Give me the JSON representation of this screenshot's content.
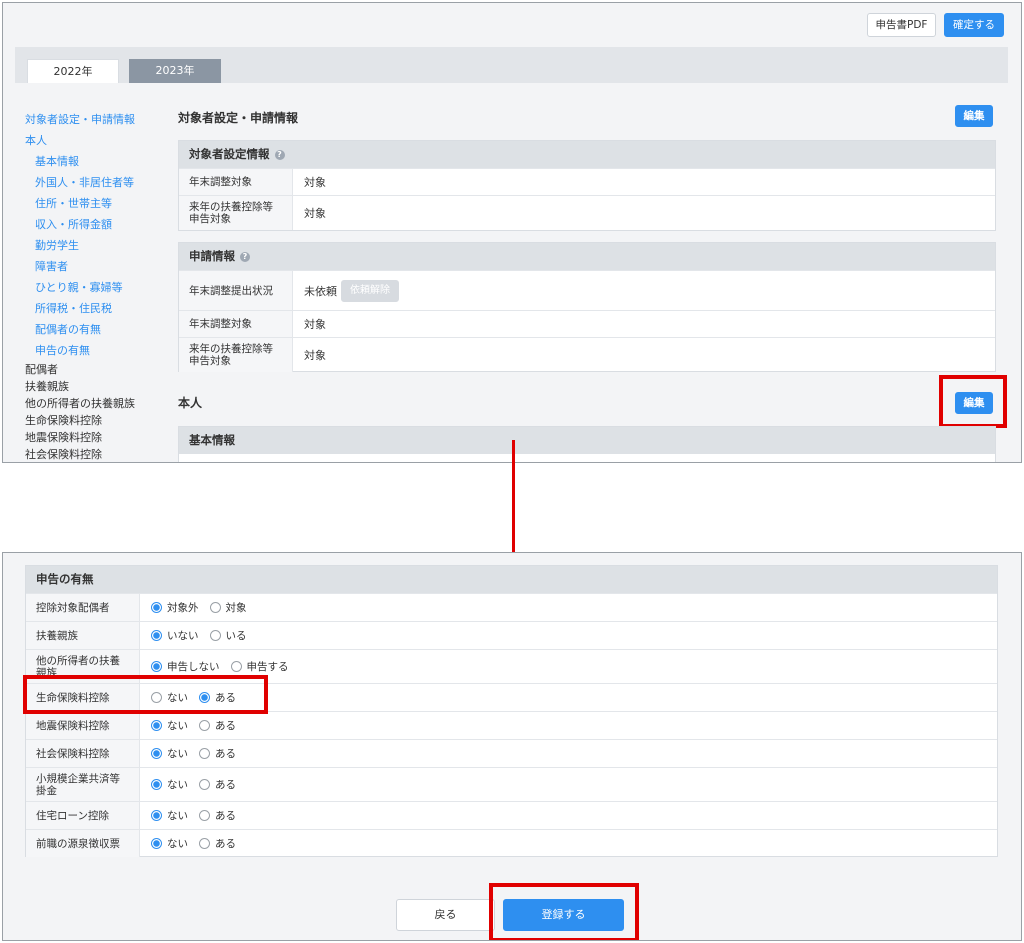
{
  "top_panel": {
    "header": {
      "pdf_button": "申告書PDF",
      "confirm_button": "確定する"
    },
    "tabs": [
      {
        "label": "2022年",
        "active": true
      },
      {
        "label": "2023年",
        "active": false
      }
    ],
    "sidebar": {
      "items": [
        {
          "label": "対象者設定・申請情報",
          "level": 1
        },
        {
          "label": "本人",
          "level": 1
        },
        {
          "label": "基本情報",
          "level": 2
        },
        {
          "label": "外国人・非居住者等",
          "level": 2
        },
        {
          "label": "住所・世帯主等",
          "level": 2
        },
        {
          "label": "収入・所得金額",
          "level": 2
        },
        {
          "label": "勤労学生",
          "level": 2
        },
        {
          "label": "障害者",
          "level": 2
        },
        {
          "label": "ひとり親・寡婦等",
          "level": 2
        },
        {
          "label": "所得税・住民税",
          "level": 2
        },
        {
          "label": "配偶者の有無",
          "level": 2
        },
        {
          "label": "申告の有無",
          "level": 2
        },
        {
          "label": "配偶者",
          "level": 0
        },
        {
          "label": "扶養親族",
          "level": 0
        },
        {
          "label": "他の所得者の扶養親族",
          "level": 0
        },
        {
          "label": "生命保険料控除",
          "level": 0
        },
        {
          "label": "地震保険料控除",
          "level": 0
        },
        {
          "label": "社会保険料控除",
          "level": 0
        }
      ]
    },
    "main": {
      "section1_title": "対象者設定・申請情報",
      "edit_label": "編集",
      "target_settings": {
        "title": "対象者設定情報",
        "help_icon": "?",
        "rows": [
          {
            "label": "年末調整対象",
            "value": "対象"
          },
          {
            "label": "来年の扶養控除等申告対象",
            "value": "対象"
          }
        ]
      },
      "request_info": {
        "title": "申請情報",
        "help_icon": "?",
        "status_label": "年末調整提出状況",
        "status_value": "未依頼",
        "cancel_button": "依頼解除",
        "rows": [
          {
            "label": "年末調整対象",
            "value": "対象"
          },
          {
            "label": "来年の扶養控除等申告対象",
            "value": "対象"
          }
        ]
      },
      "section2_title": "本人",
      "basic_info_title": "基本情報"
    }
  },
  "bottom_panel": {
    "card_title": "申告の有無",
    "rows": [
      {
        "label": "控除対象配偶者",
        "options": [
          {
            "text": "対象外",
            "checked": true
          },
          {
            "text": "対象",
            "checked": false
          }
        ]
      },
      {
        "label": "扶養親族",
        "options": [
          {
            "text": "いない",
            "checked": true
          },
          {
            "text": "いる",
            "checked": false
          }
        ]
      },
      {
        "label": "他の所得者の扶養親族",
        "options": [
          {
            "text": "申告しない",
            "checked": true
          },
          {
            "text": "申告する",
            "checked": false
          }
        ]
      },
      {
        "label": "生命保険料控除",
        "options": [
          {
            "text": "ない",
            "checked": false
          },
          {
            "text": "ある",
            "checked": true
          }
        ]
      },
      {
        "label": "地震保険料控除",
        "options": [
          {
            "text": "ない",
            "checked": true
          },
          {
            "text": "ある",
            "checked": false
          }
        ]
      },
      {
        "label": "社会保険料控除",
        "options": [
          {
            "text": "ない",
            "checked": true
          },
          {
            "text": "ある",
            "checked": false
          }
        ]
      },
      {
        "label": "小規模企業共済等掛金",
        "options": [
          {
            "text": "ない",
            "checked": true
          },
          {
            "text": "ある",
            "checked": false
          }
        ]
      },
      {
        "label": "住宅ローン控除",
        "options": [
          {
            "text": "ない",
            "checked": true
          },
          {
            "text": "ある",
            "checked": false
          }
        ]
      },
      {
        "label": "前職の源泉徴収票",
        "options": [
          {
            "text": "ない",
            "checked": true
          },
          {
            "text": "ある",
            "checked": false
          }
        ]
      }
    ],
    "back_button": "戻る",
    "submit_button": "登録する"
  },
  "colors": {
    "accent": "#2e8ff0",
    "highlight": "#e00000",
    "table_header": "#dde1e5"
  }
}
